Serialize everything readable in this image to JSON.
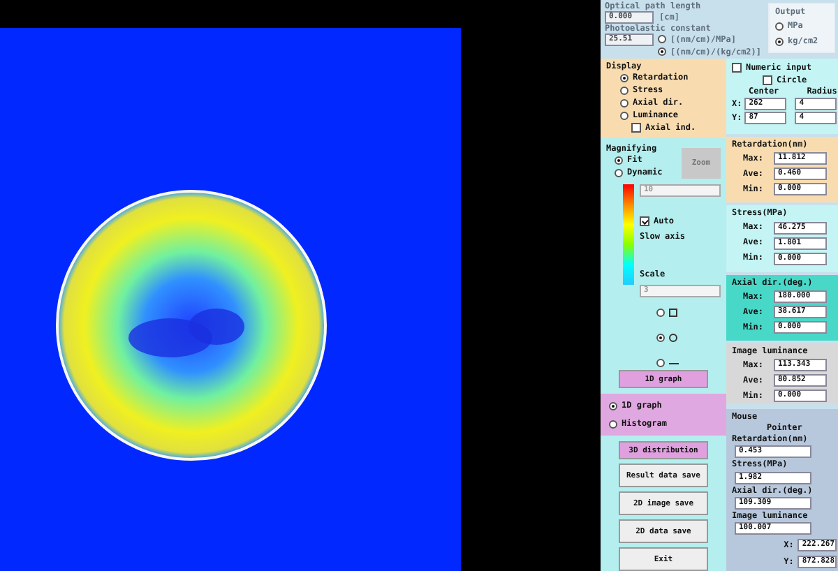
{
  "settings": {
    "disabled": true,
    "path_length": {
      "label": "Optical path length",
      "value": "0.000",
      "unit": "[cm]"
    },
    "photoelastic": {
      "label": "Photoelastic constant",
      "value": "25.51",
      "units": [
        {
          "label": "[(nm/cm)/MPa]",
          "selected": false
        },
        {
          "label": "[(nm/cm)/(kg/cm2)]",
          "selected": true
        }
      ]
    },
    "output": {
      "title": "Output",
      "options": [
        {
          "label": "MPa",
          "selected": false
        },
        {
          "label": "kg/cm2",
          "selected": true
        }
      ]
    }
  },
  "display": {
    "title": "Display",
    "options": [
      {
        "label": "Retardation",
        "selected": true
      },
      {
        "label": "Stress",
        "selected": false
      },
      {
        "label": "Axial dir.",
        "selected": false
      },
      {
        "label": "Luminance",
        "selected": false
      }
    ],
    "axial_ind": {
      "label": "Axial ind.",
      "checked": false
    }
  },
  "magnifying": {
    "title": "Magnifying",
    "options": [
      {
        "label": "Fit",
        "selected": true
      },
      {
        "label": "Dynamic",
        "selected": false
      }
    ],
    "zoom_button": "Zoom",
    "colorbar_value": "10",
    "auto": {
      "label": "Auto",
      "checked": true
    },
    "slow_axis": "Slow axis",
    "scale_title": "Scale",
    "scale_value": "3",
    "markers": [
      {
        "kind": "square",
        "selected": false
      },
      {
        "kind": "circle",
        "selected": true
      },
      {
        "kind": "line",
        "selected": false
      }
    ],
    "graph_button": "1D graph"
  },
  "graph_mode": [
    {
      "label": "1D graph",
      "selected": true
    },
    {
      "label": "Histogram",
      "selected": false
    }
  ],
  "buttons": [
    {
      "label": "3D distribution",
      "highlighted": true
    },
    {
      "label": "Result data save",
      "highlighted": false
    },
    {
      "label": "2D image save",
      "highlighted": false
    },
    {
      "label": "2D data save",
      "highlighted": false
    },
    {
      "label": "Exit",
      "highlighted": false
    }
  ],
  "numeric_input": {
    "label": "Numeric input",
    "checked": false,
    "circle": {
      "label": "Circle",
      "checked": false
    },
    "center_title": "Center",
    "radius_title": "Radius",
    "rows": [
      {
        "axis": "X:",
        "center": "262",
        "radius": "4"
      },
      {
        "axis": "Y:",
        "center": "87",
        "radius": "4"
      }
    ]
  },
  "stats": [
    {
      "title": "Retardation(nm)",
      "color": "#f8dcb0",
      "rows": [
        {
          "label": "Max:",
          "value": "11.812"
        },
        {
          "label": "Ave:",
          "value": "0.460"
        },
        {
          "label": "Min:",
          "value": "0.000"
        }
      ]
    },
    {
      "title": "Stress(MPa)",
      "color": "#c4f4f4",
      "rows": [
        {
          "label": "Max:",
          "value": "46.275"
        },
        {
          "label": "Ave:",
          "value": "1.801"
        },
        {
          "label": "Min:",
          "value": "0.000"
        }
      ]
    },
    {
      "title": "Axial dir.(deg.)",
      "color": "#48d8c8",
      "rows": [
        {
          "label": "Max:",
          "value": "180.000"
        },
        {
          "label": "Ave:",
          "value": "38.617"
        },
        {
          "label": "Min:",
          "value": "0.000"
        }
      ]
    },
    {
      "title": "Image luminance",
      "color": "#d8d8d8",
      "rows": [
        {
          "label": "Max:",
          "value": "113.343"
        },
        {
          "label": "Ave:",
          "value": "80.852"
        },
        {
          "label": "Min:",
          "value": "0.000"
        }
      ]
    }
  ],
  "mouse": {
    "title": "Mouse",
    "pointer": "Pointer",
    "fields": [
      {
        "label": "Retardation(nm)",
        "value": "0.453"
      },
      {
        "label": "Stress(MPa)",
        "value": "1.982"
      },
      {
        "label": "Axial dir.(deg.)",
        "value": "109.309"
      },
      {
        "label": "Image luminance",
        "value": "100.007"
      }
    ],
    "coords": [
      {
        "label": "X:",
        "value": "222.267"
      },
      {
        "label": "Y:",
        "value": "872.828"
      }
    ]
  }
}
